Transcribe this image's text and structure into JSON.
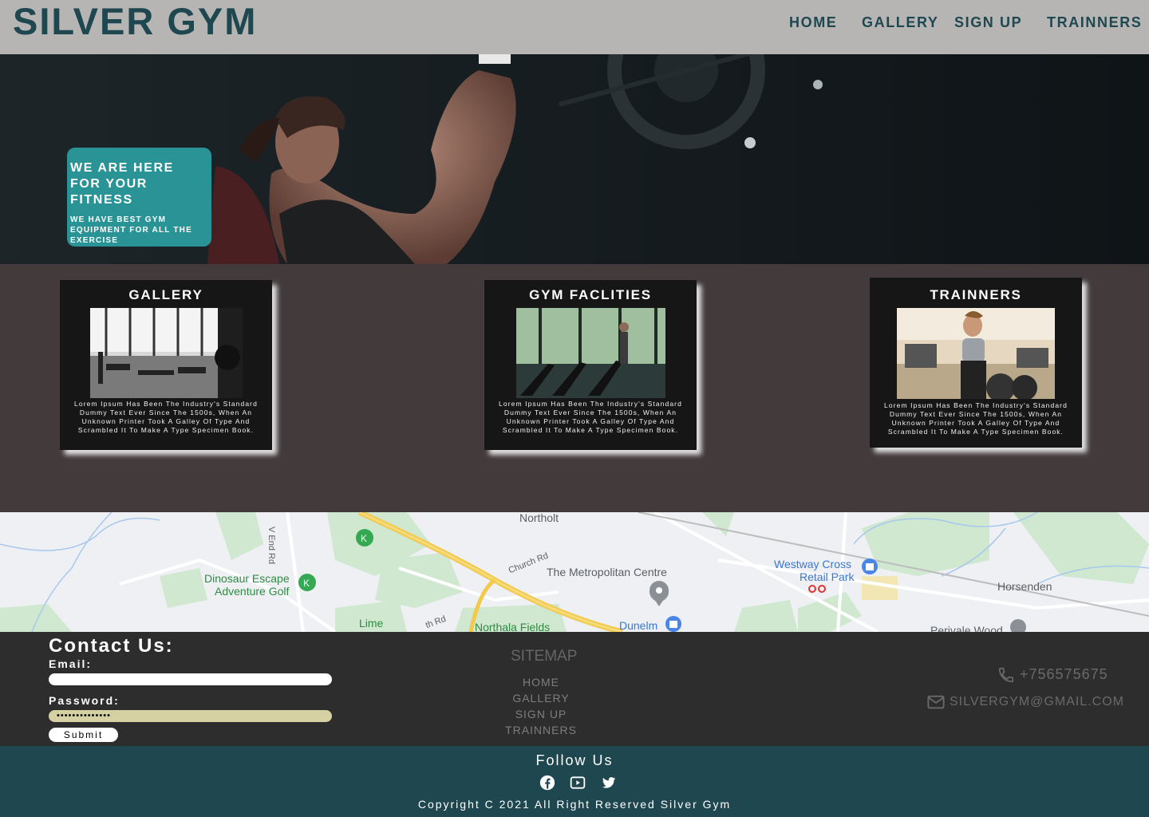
{
  "brand": "SILVER GYM",
  "nav": {
    "items": [
      {
        "label": "HOME"
      },
      {
        "label": "GALLERY"
      },
      {
        "label": "SIGN UP"
      },
      {
        "label": "TRAINNERS"
      }
    ]
  },
  "hero": {
    "title": "WE ARE HERE FOR YOUR FITNESS",
    "subtitle": "WE HAVE BEST GYM EQUIPMENT FOR ALL THE EXERCISE"
  },
  "features": [
    {
      "title": "GALLERY",
      "text": "Lorem Ipsum Has Been The Industry's Standard Dummy Text Ever Since The 1500s, When An Unknown Printer Took A Galley Of Type And Scrambled It To Make A Type Specimen Book."
    },
    {
      "title": "GYM FACLITIES",
      "text": "Lorem Ipsum Has Been The Industry's Standard Dummy Text Ever Since The 1500s, When An Unknown Printer Took A Galley Of Type And Scrambled It To Make A Type Specimen Book."
    },
    {
      "title": "TRAINNERS",
      "text": "Lorem Ipsum Has Been The Industry's Standard Dummy Text Ever Since The 1500s, When An Unknown Printer Took A Galley Of Type And Scrambled It To Make A Type Specimen Book."
    }
  ],
  "map": {
    "labels": {
      "northolt": "Northolt",
      "end_rd": "V End Rd",
      "church_rd": "Church Rd",
      "metropolitan": "The Metropolitan Centre",
      "westway1": "Westway Cross",
      "westway2": "Retail Park",
      "horsenden": "Horsenden",
      "dino1": "Dinosaur Escape",
      "dino2": "Adventure Golf",
      "lime": "Lime",
      "northala": "Northala Fields",
      "dunelm": "Dunelm",
      "th_rd": "th Rd",
      "perivale": "Perivale Wood"
    }
  },
  "contact": {
    "title": "Contact Us:",
    "email_label": "Email:",
    "email_value": "",
    "password_label": "Password:",
    "password_value": "••••••••••••••",
    "submit_label": "Submit"
  },
  "sitemap": {
    "title": "SITEMAP",
    "links": [
      "HOME",
      "GALLERY",
      "SIGN UP",
      "TRAINNERS"
    ]
  },
  "info": {
    "phone": "+756575675",
    "email": "SILVERGYM@GMAIL.COM"
  },
  "follow": {
    "title": "Follow Us",
    "icons": [
      "facebook-icon",
      "youtube-icon",
      "twitter-icon"
    ],
    "copyright": "Copyright C 2021 All Right Reserved Silver Gym"
  },
  "colors": {
    "nav_bg": "#b6b5b3",
    "brand": "#1f4750",
    "hero_card": "#2a9396",
    "section_bg": "#423a3b",
    "footer_bg": "#2e2d2d",
    "follow_bg": "#1f4750",
    "password_field": "#d6d1a2"
  }
}
